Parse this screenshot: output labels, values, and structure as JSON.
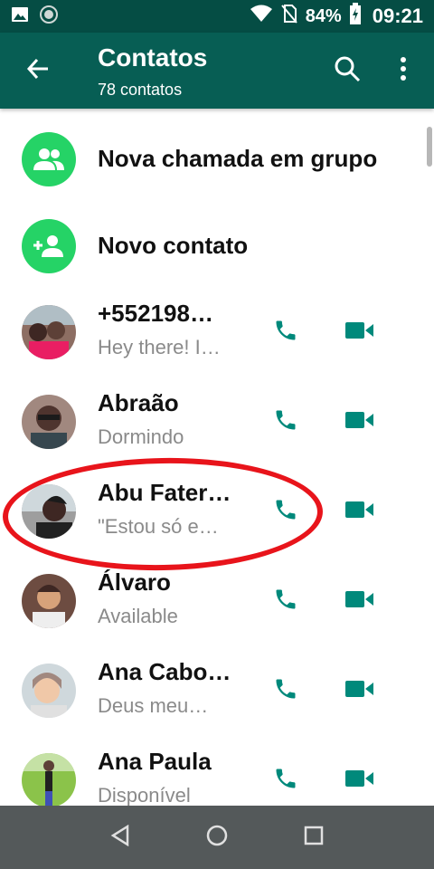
{
  "status_bar": {
    "battery": "84%",
    "time": "09:21",
    "icons": [
      "image-icon",
      "sync-icon",
      "wifi-icon",
      "no-sim-icon",
      "battery-charging-icon"
    ]
  },
  "app_bar": {
    "title": "Contatos",
    "subtitle": "78 contatos",
    "icons": [
      "back-arrow-icon",
      "search-icon",
      "more-vert-icon"
    ]
  },
  "actions": [
    {
      "label": "Nova chamada em grupo",
      "icon": "group-icon"
    },
    {
      "label": "Novo contato",
      "icon": "add-person-icon"
    }
  ],
  "contacts": [
    {
      "name": "+552198…",
      "status": "Hey there! I…"
    },
    {
      "name": "Abraão",
      "status": "Dormindo"
    },
    {
      "name": "Abu Fater…",
      "status": "\"Estou só e…"
    },
    {
      "name": "Álvaro",
      "status": "Available"
    },
    {
      "name": "Ana Cabo…",
      "status": "Deus meu…"
    },
    {
      "name": "Ana Paula",
      "status": "Disponível"
    }
  ],
  "colors": {
    "status_bar": "#054d44",
    "app_bar": "#075e54",
    "accent_green": "#25d366",
    "call_icon": "#00897b",
    "highlight": "#e8141b",
    "nav_bar": "#54595a"
  },
  "nav_bar": {
    "icons": [
      "back-triangle-icon",
      "home-circle-icon",
      "recents-square-icon"
    ]
  }
}
